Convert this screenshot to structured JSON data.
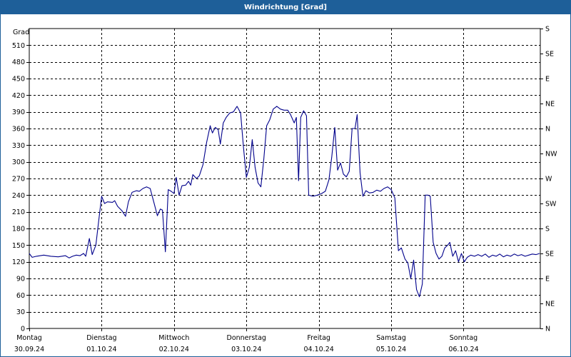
{
  "window": {
    "title": "Windrichtung [Grad]"
  },
  "chart_data": {
    "type": "line",
    "title": "Windrichtung [Grad]",
    "ylabel": "Grad",
    "xlabel": "",
    "ylim": [
      0,
      540
    ],
    "y_ticks": [
      0,
      30,
      60,
      90,
      120,
      150,
      180,
      210,
      240,
      270,
      300,
      330,
      360,
      390,
      420,
      450,
      480,
      510
    ],
    "y_right_ticks": [
      {
        "value": 0,
        "label": "N"
      },
      {
        "value": 45,
        "label": "NE"
      },
      {
        "value": 90,
        "label": "E"
      },
      {
        "value": 135,
        "label": "SE"
      },
      {
        "value": 180,
        "label": "S"
      },
      {
        "value": 225,
        "label": "SW"
      },
      {
        "value": 270,
        "label": "W"
      },
      {
        "value": 315,
        "label": "NW"
      },
      {
        "value": 360,
        "label": "N"
      },
      {
        "value": 405,
        "label": "NE"
      },
      {
        "value": 450,
        "label": "E"
      },
      {
        "value": 495,
        "label": "SE"
      },
      {
        "value": 540,
        "label": "S"
      }
    ],
    "x_range_days": [
      0,
      7.06
    ],
    "x_ticks": [
      {
        "day": 0,
        "weekday": "Montag",
        "date": "30.09.24"
      },
      {
        "day": 1,
        "weekday": "Dienstag",
        "date": "01.10.24"
      },
      {
        "day": 2,
        "weekday": "Mittwoch",
        "date": "02.10.24"
      },
      {
        "day": 3,
        "weekday": "Donnerstag",
        "date": "03.10.24"
      },
      {
        "day": 4,
        "weekday": "Freitag",
        "date": "04.10.24"
      },
      {
        "day": 5,
        "weekday": "Samstag",
        "date": "05.10.24"
      },
      {
        "day": 6,
        "weekday": "Sonntag",
        "date": "06.10.24"
      }
    ],
    "grid": true,
    "colors": {
      "line": "#00008b",
      "grid": "#000000",
      "frame": "#000000",
      "title_bar": "#1e5f99"
    },
    "series": [
      {
        "points": [
          [
            0.0,
            135
          ],
          [
            0.04,
            128
          ],
          [
            0.1,
            130
          ],
          [
            0.2,
            132
          ],
          [
            0.3,
            130
          ],
          [
            0.4,
            129
          ],
          [
            0.5,
            131
          ],
          [
            0.55,
            127
          ],
          [
            0.6,
            130
          ],
          [
            0.65,
            132
          ],
          [
            0.7,
            131
          ],
          [
            0.75,
            135
          ],
          [
            0.78,
            130
          ],
          [
            0.83,
            162
          ],
          [
            0.87,
            133
          ],
          [
            0.92,
            150
          ],
          [
            0.96,
            195
          ],
          [
            1.0,
            238
          ],
          [
            1.04,
            225
          ],
          [
            1.08,
            228
          ],
          [
            1.15,
            227
          ],
          [
            1.18,
            230
          ],
          [
            1.22,
            220
          ],
          [
            1.28,
            212
          ],
          [
            1.33,
            202
          ],
          [
            1.37,
            228
          ],
          [
            1.42,
            245
          ],
          [
            1.48,
            248
          ],
          [
            1.52,
            247
          ],
          [
            1.57,
            252
          ],
          [
            1.62,
            255
          ],
          [
            1.67,
            252
          ],
          [
            1.72,
            228
          ],
          [
            1.77,
            203
          ],
          [
            1.81,
            215
          ],
          [
            1.84,
            213
          ],
          [
            1.88,
            138
          ],
          [
            1.92,
            250
          ],
          [
            1.96,
            247
          ],
          [
            2.0,
            243
          ],
          [
            2.03,
            272
          ],
          [
            2.07,
            240
          ],
          [
            2.11,
            257
          ],
          [
            2.16,
            258
          ],
          [
            2.2,
            265
          ],
          [
            2.23,
            258
          ],
          [
            2.26,
            277
          ],
          [
            2.31,
            270
          ],
          [
            2.35,
            275
          ],
          [
            2.4,
            295
          ],
          [
            2.45,
            335
          ],
          [
            2.5,
            365
          ],
          [
            2.53,
            352
          ],
          [
            2.57,
            362
          ],
          [
            2.61,
            358
          ],
          [
            2.64,
            332
          ],
          [
            2.68,
            370
          ],
          [
            2.72,
            380
          ],
          [
            2.77,
            388
          ],
          [
            2.82,
            390
          ],
          [
            2.87,
            400
          ],
          [
            2.92,
            388
          ],
          [
            2.96,
            325
          ],
          [
            3.0,
            272
          ],
          [
            3.04,
            290
          ],
          [
            3.08,
            340
          ],
          [
            3.12,
            290
          ],
          [
            3.16,
            262
          ],
          [
            3.2,
            255
          ],
          [
            3.24,
            305
          ],
          [
            3.28,
            365
          ],
          [
            3.32,
            375
          ],
          [
            3.37,
            395
          ],
          [
            3.42,
            400
          ],
          [
            3.47,
            395
          ],
          [
            3.52,
            393
          ],
          [
            3.57,
            393
          ],
          [
            3.61,
            385
          ],
          [
            3.66,
            370
          ],
          [
            3.69,
            380
          ],
          [
            3.72,
            266
          ],
          [
            3.75,
            380
          ],
          [
            3.79,
            392
          ],
          [
            3.83,
            383
          ],
          [
            3.86,
            240
          ],
          [
            3.92,
            238
          ],
          [
            3.98,
            240
          ],
          [
            4.04,
            243
          ],
          [
            4.09,
            247
          ],
          [
            4.14,
            268
          ],
          [
            4.18,
            310
          ],
          [
            4.22,
            362
          ],
          [
            4.26,
            285
          ],
          [
            4.3,
            298
          ],
          [
            4.34,
            278
          ],
          [
            4.38,
            273
          ],
          [
            4.42,
            283
          ],
          [
            4.46,
            360
          ],
          [
            4.5,
            360
          ],
          [
            4.53,
            385
          ],
          [
            4.57,
            280
          ],
          [
            4.61,
            238
          ],
          [
            4.65,
            248
          ],
          [
            4.7,
            244
          ],
          [
            4.75,
            245
          ],
          [
            4.8,
            249
          ],
          [
            4.85,
            247
          ],
          [
            4.9,
            252
          ],
          [
            4.95,
            255
          ],
          [
            5.0,
            250
          ],
          [
            5.05,
            235
          ],
          [
            5.1,
            140
          ],
          [
            5.14,
            145
          ],
          [
            5.19,
            125
          ],
          [
            5.23,
            118
          ],
          [
            5.27,
            90
          ],
          [
            5.31,
            123
          ],
          [
            5.35,
            70
          ],
          [
            5.39,
            57
          ],
          [
            5.43,
            80
          ],
          [
            5.47,
            240
          ],
          [
            5.51,
            240
          ],
          [
            5.54,
            238
          ],
          [
            5.58,
            155
          ],
          [
            5.62,
            135
          ],
          [
            5.66,
            125
          ],
          [
            5.7,
            130
          ],
          [
            5.74,
            145
          ],
          [
            5.78,
            150
          ],
          [
            5.81,
            155
          ],
          [
            5.85,
            130
          ],
          [
            5.89,
            140
          ],
          [
            5.93,
            120
          ],
          [
            5.97,
            135
          ],
          [
            6.01,
            120
          ],
          [
            6.05,
            128
          ],
          [
            6.1,
            132
          ],
          [
            6.15,
            130
          ],
          [
            6.2,
            133
          ],
          [
            6.25,
            130
          ],
          [
            6.3,
            134
          ],
          [
            6.35,
            128
          ],
          [
            6.4,
            132
          ],
          [
            6.45,
            130
          ],
          [
            6.5,
            134
          ],
          [
            6.55,
            129
          ],
          [
            6.6,
            132
          ],
          [
            6.65,
            130
          ],
          [
            6.7,
            134
          ],
          [
            6.75,
            131
          ],
          [
            6.8,
            133
          ],
          [
            6.85,
            130
          ],
          [
            6.9,
            132
          ],
          [
            6.95,
            134
          ],
          [
            7.0,
            133
          ],
          [
            7.05,
            135
          ]
        ]
      }
    ]
  }
}
